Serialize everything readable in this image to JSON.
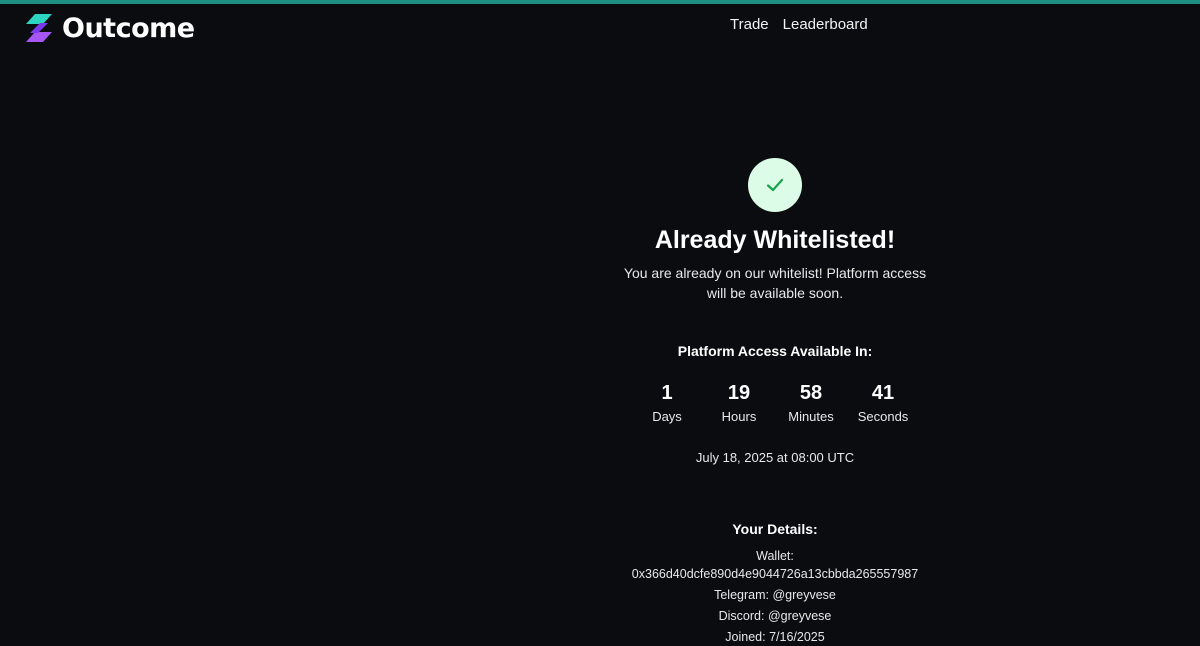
{
  "brand": {
    "name": "Outcome",
    "accent_top": "#1f8f82",
    "logo_colors": [
      "#2dd4bf",
      "#a855f7"
    ]
  },
  "nav": {
    "items": [
      {
        "label": "Trade"
      },
      {
        "label": "Leaderboard"
      }
    ]
  },
  "status": {
    "icon": "check-icon",
    "icon_bg": "#dcfce7",
    "icon_color": "#16a34a",
    "title": "Already Whitelisted!",
    "message": "You are already on our whitelist! Platform access will be available soon."
  },
  "countdown": {
    "title": "Platform Access Available In:",
    "units": [
      {
        "value": "1",
        "label": "Days"
      },
      {
        "value": "19",
        "label": "Hours"
      },
      {
        "value": "58",
        "label": "Minutes"
      },
      {
        "value": "41",
        "label": "Seconds"
      }
    ],
    "launch_text": "July 18, 2025 at 08:00 UTC"
  },
  "details": {
    "title": "Your Details:",
    "wallet_label": "Wallet:",
    "wallet_address": "0x366d40dcfe890d4e9044726a13cbbda265557987",
    "telegram": "Telegram: @greyvese",
    "discord": "Discord: @greyvese",
    "joined": "Joined: 7/16/2025"
  }
}
